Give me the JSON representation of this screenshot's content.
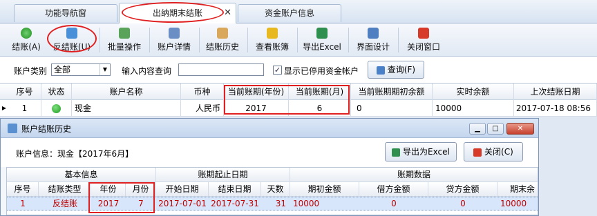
{
  "tabs": [
    {
      "label": "功能导航窗"
    },
    {
      "label": "出纳期末结账",
      "close": "✕"
    },
    {
      "label": "资金账户信息"
    }
  ],
  "toolbar": {
    "items": [
      {
        "label": "结账(A)",
        "icon": "check-icon"
      },
      {
        "label": "反结账(U)",
        "icon": "undo-icon"
      },
      {
        "label": "批量操作",
        "icon": "batch-icon"
      },
      {
        "label": "账户详情",
        "icon": "detail-icon"
      },
      {
        "label": "结账历史",
        "icon": "history-icon"
      },
      {
        "label": "查看账簿",
        "icon": "book-icon"
      },
      {
        "label": "导出Excel",
        "icon": "excel-icon"
      },
      {
        "label": "界面设计",
        "icon": "design-icon"
      },
      {
        "label": "关闭窗口",
        "icon": "close-icon"
      }
    ]
  },
  "filter": {
    "account_type_label": "账户类别",
    "account_type_value": "全部",
    "query_label": "输入内容查询",
    "query_value": "",
    "show_disabled_label": "显示已停用资金帐户",
    "show_disabled_checked": "✓",
    "query_button": "查询(F)"
  },
  "grid": {
    "columns": [
      "序号",
      "状态",
      "账户名称",
      "币种",
      "当前账期(年份)",
      "当前账期(月)",
      "当前账期期初余额",
      "实时余额",
      "上次结账日期"
    ],
    "rows": [
      {
        "index": "1",
        "status": "active",
        "name": "现金",
        "currency": "人民币",
        "year": "2017",
        "month": "6",
        "opening": "0",
        "balance": "10000",
        "last_close": "2017-07-18 08:56"
      }
    ]
  },
  "dialog": {
    "title": "账户结账历史",
    "info": "账户信息：现金【2017年6月】",
    "export_button": "导出为Excel",
    "close_button": "关闭(C)",
    "group_headers": [
      "基本信息",
      "账期起止日期",
      "账期数据"
    ],
    "columns": [
      "序号",
      "结账类型",
      "年份",
      "月份",
      "开始日期",
      "结束日期",
      "天数",
      "期初金额",
      "借方金额",
      "贷方金额",
      "期末余"
    ],
    "rows": [
      {
        "index": "1",
        "type": "反结账",
        "year": "2017",
        "month": "7",
        "start": "2017-07-01",
        "end": "2017-07-31",
        "days": "31",
        "opening": "10000",
        "debit": "0",
        "credit": "0",
        "closing": "10000"
      }
    ]
  },
  "colors": {
    "highlight_red": "#e02020",
    "row_select": "#d7e6fa",
    "status_green": "#1e9a1e"
  }
}
